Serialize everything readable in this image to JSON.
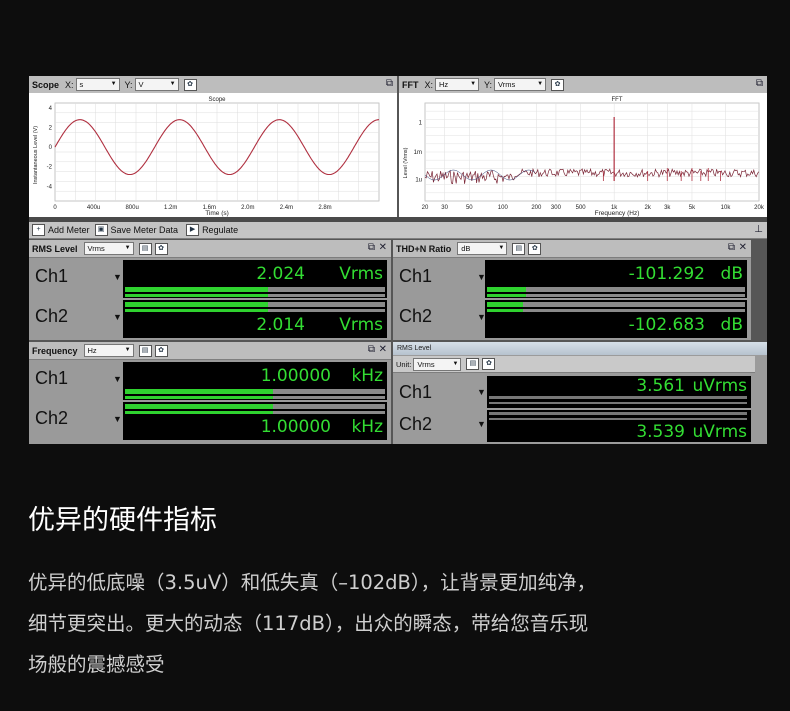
{
  "scope": {
    "title": "Scope",
    "x_label": "X:",
    "x_unit": "s",
    "y_label": "Y:",
    "y_unit": "V",
    "chart_title": "Scope",
    "xlabel": "Time (s)",
    "ylabel": "Instantaneous Level (V)",
    "y_ticks": [
      "4",
      "2",
      "0",
      "-2",
      "-4"
    ],
    "x_ticks": [
      "0",
      "400u",
      "800u",
      "1.2m",
      "1.6m",
      "2.0m",
      "2.4m",
      "2.8m"
    ]
  },
  "fft": {
    "title": "FFT",
    "x_label": "X:",
    "x_unit": "Hz",
    "y_label": "Y:",
    "y_unit": "Vrms",
    "chart_title": "FFT",
    "xlabel": "Frequency (Hz)",
    "ylabel": "Level (Vrms)",
    "y_ticks": [
      "1",
      "1m",
      "1u"
    ],
    "x_ticks": [
      "20",
      "30",
      "50",
      "100",
      "200",
      "300",
      "500",
      "1k",
      "2k",
      "3k",
      "5k",
      "10k",
      "20k"
    ]
  },
  "toolbar": {
    "add_meter": "Add Meter",
    "save_meter": "Save Meter Data",
    "regulate": "Regulate"
  },
  "rms_level": {
    "title": "RMS Level",
    "unit": "Vrms",
    "ch1": {
      "label": "Ch1",
      "value": "2.024",
      "unit": "Vrms",
      "level": 0.55
    },
    "ch2": {
      "label": "Ch2",
      "value": "2.014",
      "unit": "Vrms",
      "level": 0.55
    }
  },
  "thd": {
    "title": "THD+N Ratio",
    "unit": "dB",
    "ch1": {
      "label": "Ch1",
      "value": "-101.292",
      "unit": "dB",
      "level": 0.15
    },
    "ch2": {
      "label": "Ch2",
      "value": "-102.683",
      "unit": "dB",
      "level": 0.14
    }
  },
  "frequency": {
    "title": "Frequency",
    "unit": "Hz",
    "ch1": {
      "label": "Ch1",
      "value": "1.00000",
      "unit": "kHz",
      "level": 0.57
    },
    "ch2": {
      "label": "Ch2",
      "value": "1.00000",
      "unit": "kHz",
      "level": 0.57
    }
  },
  "rms_level2": {
    "title": "RMS Level",
    "unit_label": "Unit:",
    "unit": "Vrms",
    "ch1": {
      "label": "Ch1",
      "value": "3.561",
      "unit": "uVrms"
    },
    "ch2": {
      "label": "Ch2",
      "value": "3.539",
      "unit": "uVrms"
    }
  },
  "heading": "优异的硬件指标",
  "paragraph": {
    "line1": "优异的低底噪（3.5uV）和低失真（–102dB），让背景更加纯净，",
    "line2": "细节更突出。更大的动态（117dB），出众的瞬态，带给您音乐现",
    "line3": "场般的震撼感受"
  },
  "colors": {
    "meter_green": "#33dd33",
    "bar_fill": "#2fd22f",
    "trace": "#b03040"
  }
}
